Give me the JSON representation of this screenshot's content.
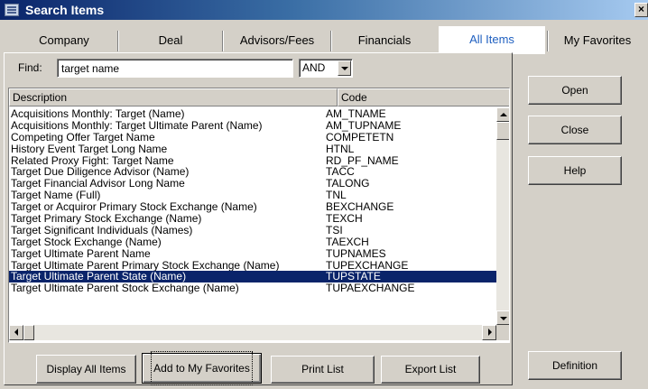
{
  "window": {
    "title": "Search Items",
    "close_glyph": "×"
  },
  "tabs": [
    {
      "label": "Company"
    },
    {
      "label": "Deal"
    },
    {
      "label": "Advisors/Fees"
    },
    {
      "label": "Financials"
    },
    {
      "label": "All Items",
      "active": true
    },
    {
      "label": "My Favorites"
    }
  ],
  "find": {
    "label": "Find:",
    "value": "target name",
    "operator": "AND"
  },
  "grid": {
    "columns": [
      "Description",
      "Code"
    ],
    "selected_index": 14,
    "rows": [
      {
        "description": "Acquisitions Monthly: Target (Name)",
        "code": "AM_TNAME"
      },
      {
        "description": "Acquisitions Monthly: Target Ultimate Parent (Name)",
        "code": "AM_TUPNAME"
      },
      {
        "description": "Competing Offer Target Name",
        "code": "COMPETETN"
      },
      {
        "description": "History Event Target Long Name",
        "code": "HTNL"
      },
      {
        "description": "Related Proxy Fight: Target Name",
        "code": "RD_PF_NAME"
      },
      {
        "description": "Target Due Diligence Advisor (Name)",
        "code": "TACC"
      },
      {
        "description": "Target Financial Advisor Long Name",
        "code": "TALONG"
      },
      {
        "description": "Target Name (Full)",
        "code": "TNL"
      },
      {
        "description": "Target or Acquiror Primary Stock Exchange (Name)",
        "code": "BEXCHANGE"
      },
      {
        "description": "Target Primary Stock Exchange (Name)",
        "code": "TEXCH"
      },
      {
        "description": "Target Significant Individuals (Names)",
        "code": "TSI"
      },
      {
        "description": "Target Stock Exchange (Name)",
        "code": "TAEXCH"
      },
      {
        "description": "Target Ultimate Parent Name",
        "code": "TUPNAMES"
      },
      {
        "description": "Target Ultimate Parent Primary Stock Exchange (Name)",
        "code": "TUPEXCHANGE"
      },
      {
        "description": "Target Ultimate Parent State (Name)",
        "code": "TUPSTATE"
      },
      {
        "description": "Target Ultimate Parent Stock Exchange (Name)",
        "code": "TUPAEXCHANGE"
      }
    ]
  },
  "buttons": {
    "open": "Open",
    "close": "Close",
    "help": "Help",
    "definition": "Definition",
    "display_all": "Display All Items",
    "add_favorites": "Add to My Favorites",
    "print_list": "Print List",
    "export_list": "Export List"
  },
  "icons": {
    "app": "window-app-icon",
    "scroll_up": "arrow-up-icon",
    "scroll_down": "arrow-down-icon",
    "scroll_left": "arrow-left-icon",
    "scroll_right": "arrow-right-icon",
    "dropdown": "chevron-down-icon"
  },
  "colors": {
    "selection": "#0a246a",
    "active_tab_text": "#2060c0",
    "title_bar": "#0a246a"
  }
}
